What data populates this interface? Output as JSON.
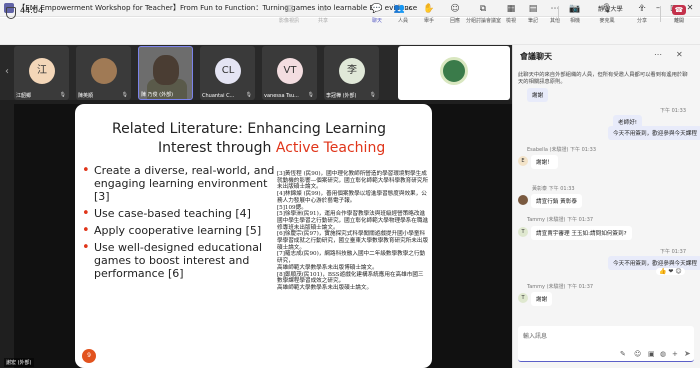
{
  "window": {
    "title": "【EMI Empowerment Workshop for Teacher】From Fun to Function：Turning games into learnable EMI evidence",
    "org": "靜宜大學"
  },
  "meeting": {
    "timer": "44:04",
    "people_count": "26"
  },
  "toolbar": {
    "view": "影像視訊",
    "share": "共享",
    "chat": "聊天",
    "people": "人員",
    "raise": "舉手",
    "react": "回應",
    "rooms": "分組討論會議室",
    "view2": "檢視",
    "notes": "筆記",
    "more": "其他",
    "camera": "相機",
    "mic": "麥克風",
    "share2": "分享",
    "leave": "離開"
  },
  "participants": [
    {
      "initial": "江",
      "name": "江韶鄉",
      "color": "#f3d6b8"
    },
    {
      "initial": "",
      "name": "陳英順",
      "color": "#a07a55"
    },
    {
      "initial": "",
      "name": "陳 乃俊 (外部)",
      "color": "#777"
    },
    {
      "initial": "CL",
      "name": "Chuantai C...",
      "color": "#e4e4f3"
    },
    {
      "initial": "VT",
      "name": "vanessa Tsu...",
      "color": "#f3dde0"
    },
    {
      "initial": "李",
      "name": "李冠樺 (外部)",
      "color": "#e0e8d8"
    }
  ],
  "slide": {
    "title_line1": "Related Literature: Enhancing Learning",
    "title_line2_plain": "Interest through ",
    "title_line2_accent": "Active Teaching",
    "bullets": [
      "Create a diverse, real-world, and engaging learning environment [3]",
      "Use case-based teaching [4]",
      "Apply cooperative learning [5]",
      "Use well-designed educational games to boost interest and performance [6]"
    ],
    "refs": "[3]黃恆程 (民90)，國中理化教師所營造的學習環境對學生成就動機的影響—個案研究，國立彰化師範大學科學教育研究所未出版碩士論文。\n[4]林錦燦 (民99)，善用個案教學以增進學習態度與效果，公務人力發展中心游於藝電子報。\n[5]109鍶。\n[5]徐學洲(民91)，運用合作學習教學法與班級經營策略改進國中學生學習之行動研究，國立彰化師範大學物理學系在職進修專班未出版碩士論文。\n[6]徐慶宗(民97)，實施探究式科學闖關遊戲提升國小學童科學學習成就之行動研究，國立臺東大學數學教育研究所未出版碩士論文。\n[7]羅志成(民90)，網路科技融入國中二年級數學教學之行動研究，\n高雄師範大學數學系未出版博碩士論文。\n[8]鄭順茂(民101)，BSS遊戲化建構系統應用在高雄市國三數學課程學習成效之研究，\n高雄師範大學數學系未出版碩士論文。",
    "page": "9"
  },
  "presenter": "謝宏 (外部)",
  "chat": {
    "title": "會議聊天",
    "notice": "此聊天中的來自外部組織的人員，但所有受邀人員都可以看到有遙用於聊天的相關訊息原則。",
    "messages": [
      {
        "type": "self",
        "text": "謝謝",
        "time": ""
      },
      {
        "type": "self",
        "time": "下午 01:33",
        "text": "老師好!"
      },
      {
        "type": "self",
        "time": "",
        "text": "今天不用簽到，歡迎參與今天課程"
      },
      {
        "type": "other",
        "sender": "Esabella (未驗證)",
        "time": "下午 01:33",
        "text": "謝謝！",
        "initial": "E"
      },
      {
        "type": "other",
        "sender": "黃彰泰",
        "time": "下午 01:33",
        "text": "請宣行銷 黃彰泰",
        "initial": ""
      },
      {
        "type": "other",
        "sender": "Tammy (未驗證)",
        "time": "下午 01:37",
        "text": "請宣賣宇審理 王玉如:請問如何簽到?",
        "initial": "T"
      },
      {
        "type": "self",
        "time": "下午 01:37",
        "text": "今天不用簽到，歡迎參與今天課程"
      },
      {
        "type": "other",
        "sender": "Tammy (未驗證)",
        "time": "下午 01:37",
        "text": "謝謝",
        "initial": "T"
      }
    ],
    "reaction": "👍 ❤ 😊",
    "compose_placeholder": "輸入訊息"
  }
}
